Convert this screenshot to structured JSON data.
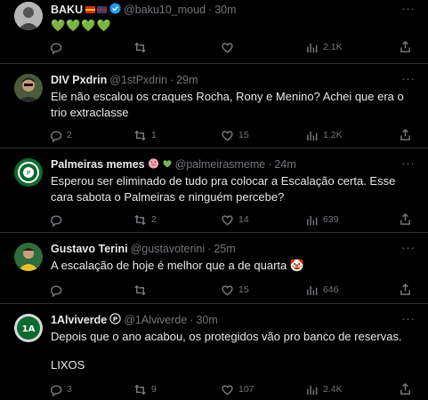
{
  "tweets": [
    {
      "name": "BAKU",
      "handle": "@baku10_moud",
      "sep": "·",
      "time": "30m",
      "text": "💚💚💚💚",
      "replies": "",
      "retweets": "",
      "likes": "",
      "views": "2.1K"
    },
    {
      "name": "DIV Pxdrin",
      "handle": "@1stPxdrin",
      "sep": "·",
      "time": "29m",
      "text": "Ele não escalou os craques Rocha, Rony e Menino? Achei que era o trio extraclasse",
      "replies": "2",
      "retweets": "1",
      "likes": "15",
      "views": "1.2K"
    },
    {
      "name": "Palmeiras memes",
      "handle": "@palmeirasmeme",
      "sep": "·",
      "time": "24m",
      "text": "Esperou ser eliminado de tudo pra colocar a Escalação certa. Esse cara sabota o Palmeiras e ninguém percebe?",
      "replies": "",
      "retweets": "2",
      "likes": "14",
      "views": "639"
    },
    {
      "name": "Gustavo Terini",
      "handle": "@gustavoterini",
      "sep": "·",
      "time": "25m",
      "text": "A escalação de hoje é melhor que a de quarta 🤡",
      "replies": "",
      "retweets": "",
      "likes": "15",
      "views": "646"
    },
    {
      "name": "1Alviverde",
      "handle": "@1Alviverde",
      "sep": "·",
      "time": "30m",
      "text": "Depois que o ano acabou, os protegidos vão pro banco de reservas.",
      "text2": "LIXOS",
      "replies": "3",
      "retweets": "9",
      "likes": "107",
      "views": "2.4K"
    }
  ],
  "icons": {
    "more": "more-icon",
    "reply": "reply-icon",
    "retweet": "retweet-icon",
    "like": "like-icon",
    "views": "views-icon",
    "share": "share-icon",
    "verified": "verified-badge-icon"
  },
  "colors": {
    "background": "#000000",
    "border": "#2f3336",
    "text": "#e7e9ea",
    "muted": "#71767b",
    "verified_blue": "#1d9bf0",
    "heart_green": "#78b159"
  }
}
